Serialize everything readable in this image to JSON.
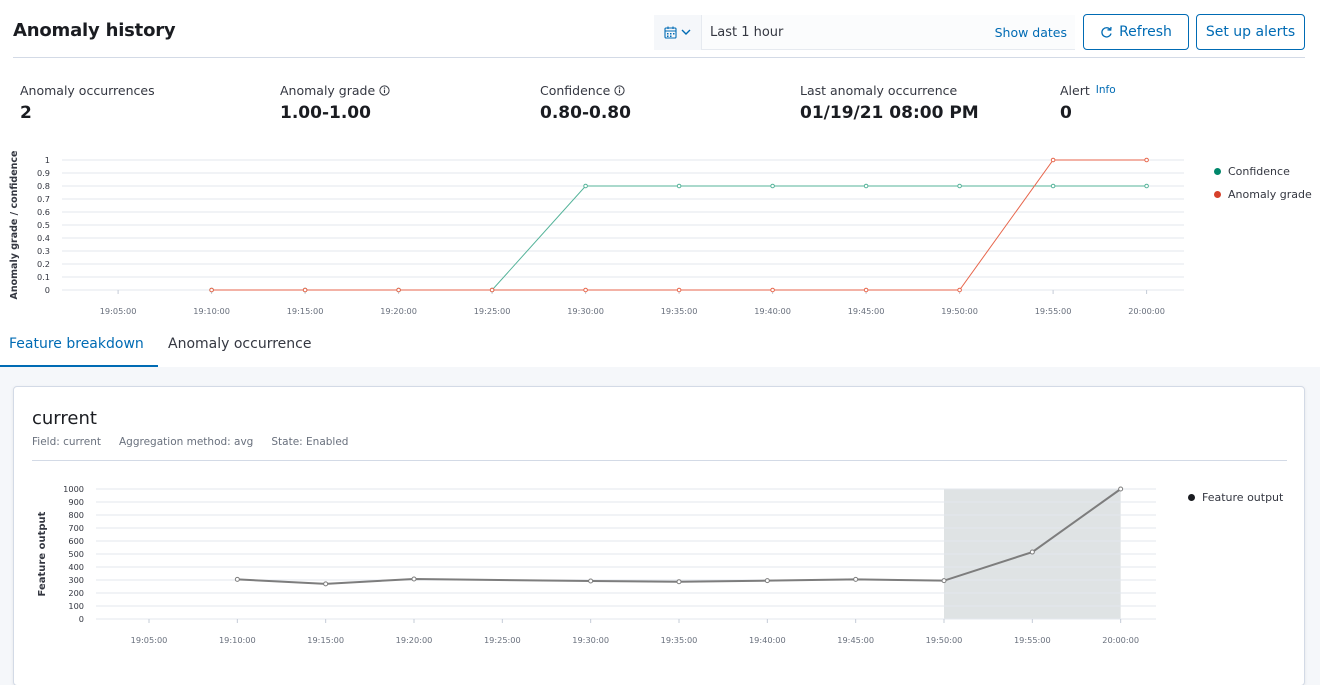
{
  "header": {
    "title": "Anomaly history",
    "date_range": "Last 1 hour",
    "show_dates": "Show dates",
    "refresh_label": "Refresh",
    "alerts_label": "Set up alerts"
  },
  "stats": [
    {
      "label": "Anomaly occurrences",
      "value": "2",
      "icon": ""
    },
    {
      "label": "Anomaly grade",
      "value": "1.00-1.00",
      "icon": "info-icon"
    },
    {
      "label": "Confidence",
      "value": "0.80-0.80",
      "icon": "info-icon"
    },
    {
      "label": "Last anomaly occurrence",
      "value": "01/19/21 08:00 PM",
      "icon": ""
    },
    {
      "label": "Alert",
      "value": "0",
      "link": "Info"
    }
  ],
  "anomaly_chart": {
    "ylabel": "Anomaly grade / confidence",
    "legend": [
      {
        "name": "Confidence",
        "color": "#00876b"
      },
      {
        "name": "Anomaly grade",
        "color": "#d6412b"
      }
    ]
  },
  "tabs": [
    {
      "label": "Feature breakdown",
      "active": true
    },
    {
      "label": "Anomaly occurrence",
      "active": false
    }
  ],
  "feature": {
    "title": "current",
    "field": "Field: current",
    "aggregation": "Aggregation method: avg",
    "state": "State: Enabled",
    "ylabel": "Feature output",
    "legend": "Feature output"
  },
  "chart_data": [
    {
      "type": "line",
      "ylabel": "Anomaly grade / confidence",
      "x_ticks": [
        "19:05:00",
        "19:10:00",
        "19:15:00",
        "19:20:00",
        "19:25:00",
        "19:30:00",
        "19:35:00",
        "19:40:00",
        "19:45:00",
        "19:50:00",
        "19:55:00",
        "20:00:00"
      ],
      "y_ticks": [
        0,
        0.1,
        0.2,
        0.3,
        0.4,
        0.5,
        0.6,
        0.7,
        0.8,
        0.9,
        1
      ],
      "ylim": [
        0,
        1
      ],
      "grid": true,
      "legend_position": "right",
      "series": [
        {
          "name": "Confidence",
          "color": "#54b399",
          "x": [
            "19:10:00",
            "19:15:00",
            "19:20:00",
            "19:25:00",
            "19:30:00",
            "19:35:00",
            "19:40:00",
            "19:45:00",
            "19:50:00",
            "19:55:00",
            "20:00:00"
          ],
          "values": [
            0,
            0,
            0,
            0,
            0.8,
            0.8,
            0.8,
            0.8,
            0.8,
            0.8,
            0.8
          ]
        },
        {
          "name": "Anomaly grade",
          "color": "#e7664c",
          "x": [
            "19:10:00",
            "19:15:00",
            "19:20:00",
            "19:25:00",
            "19:30:00",
            "19:35:00",
            "19:40:00",
            "19:45:00",
            "19:50:00",
            "19:55:00",
            "20:00:00"
          ],
          "values": [
            0,
            0,
            0,
            0,
            0,
            0,
            0,
            0,
            0,
            1,
            1
          ]
        }
      ]
    },
    {
      "type": "line",
      "ylabel": "Feature output",
      "x_ticks": [
        "19:05:00",
        "19:10:00",
        "19:15:00",
        "19:20:00",
        "19:25:00",
        "19:30:00",
        "19:35:00",
        "19:40:00",
        "19:45:00",
        "19:50:00",
        "19:55:00",
        "20:00:00"
      ],
      "y_ticks": [
        0,
        100,
        200,
        300,
        400,
        500,
        600,
        700,
        800,
        900,
        1000
      ],
      "ylim": [
        0,
        1000
      ],
      "grid": true,
      "legend_position": "right",
      "highlight_range": [
        "19:50:00",
        "20:00:00"
      ],
      "series": [
        {
          "name": "Feature output",
          "color": "#7d7d7d",
          "x": [
            "19:10:00",
            "19:15:00",
            "19:20:00",
            "19:30:00",
            "19:35:00",
            "19:40:00",
            "19:45:00",
            "19:50:00",
            "19:55:00",
            "20:00:00"
          ],
          "values": [
            305,
            270,
            308,
            292,
            287,
            295,
            305,
            295,
            515,
            1000
          ]
        }
      ]
    }
  ]
}
